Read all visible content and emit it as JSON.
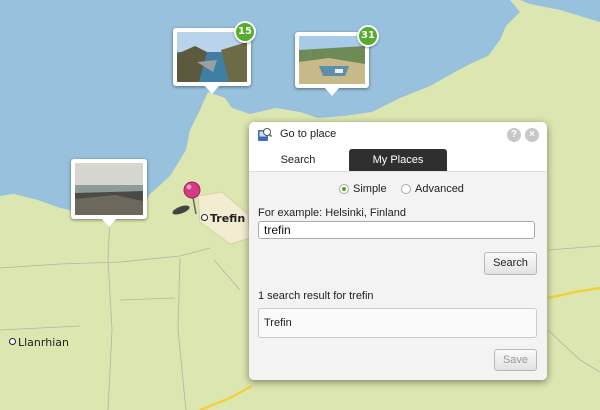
{
  "map": {
    "colors": {
      "land": "#dce6b0",
      "sea": "#97c1dd",
      "road": "#f0d240",
      "boundary": "#b7b2a4"
    },
    "places": [
      {
        "name": "Trefin",
        "bold": true
      },
      {
        "name": "Llanrhian",
        "bold": false
      }
    ],
    "photo_pins": [
      {
        "id": "cove",
        "count": "15"
      },
      {
        "id": "harbour",
        "count": "31"
      },
      {
        "id": "beach",
        "count": ""
      }
    ],
    "search_marker": "map-pin-icon"
  },
  "dialog": {
    "title": "Go to place",
    "tabs": [
      {
        "label": "Search",
        "active": true
      },
      {
        "label": "My Places",
        "active": false
      }
    ],
    "mode_options": [
      {
        "label": "Simple",
        "selected": true
      },
      {
        "label": "Advanced",
        "selected": false
      }
    ],
    "example_text": "For example: Helsinki, Finland",
    "query": "trefin",
    "search_button": "Search",
    "result_count": "1 search result for trefin",
    "results": [
      "Trefin"
    ],
    "save_button": "Save",
    "help_icon": "?",
    "close_icon": "×",
    "accent": "#45a92b"
  }
}
